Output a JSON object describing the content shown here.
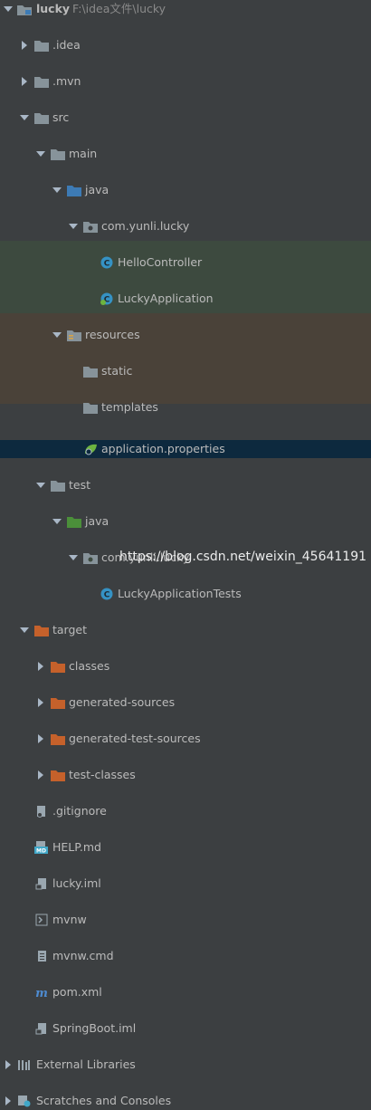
{
  "project": {
    "name": "lucky",
    "path": "F:\\idea文件\\lucky"
  },
  "folders": {
    "idea": ".idea",
    "mvn": ".mvn",
    "src": "src",
    "main": "main",
    "java": "java",
    "package_main": "com.yunli.lucky",
    "hello_controller": "HelloController",
    "lucky_application": "LuckyApplication",
    "resources": "resources",
    "static": "static",
    "templates": "templates",
    "application_properties": "application.properties",
    "test": "test",
    "test_java": "java",
    "package_test": "com.yunli.lucky",
    "lucky_application_tests": "LuckyApplicationTests",
    "target": "target",
    "classes": "classes",
    "generated_sources": "generated-sources",
    "generated_test_sources": "generated-test-sources",
    "test_classes": "test-classes"
  },
  "files": {
    "gitignore": ".gitignore",
    "help": "HELP.md",
    "lucky_iml": "lucky.iml",
    "mvnw": "mvnw",
    "mvnw_cmd": "mvnw.cmd",
    "pom": "pom.xml",
    "springboot_iml": "SpringBoot.iml"
  },
  "footer": {
    "external_libraries": "External Libraries",
    "scratches": "Scratches and Consoles"
  },
  "watermark": "https://blog.csdn.net/weixin_45641191",
  "colors": {
    "background": "#3c3f41",
    "selection": "#0d293e",
    "test_tint": "#3d4a3f",
    "target_tint": "#4a4239",
    "folder": "#87939a",
    "source_folder": "#3d7bb5",
    "test_folder": "#4b8f3a",
    "excluded_folder": "#c5612b",
    "class_icon": "#3592c4"
  }
}
